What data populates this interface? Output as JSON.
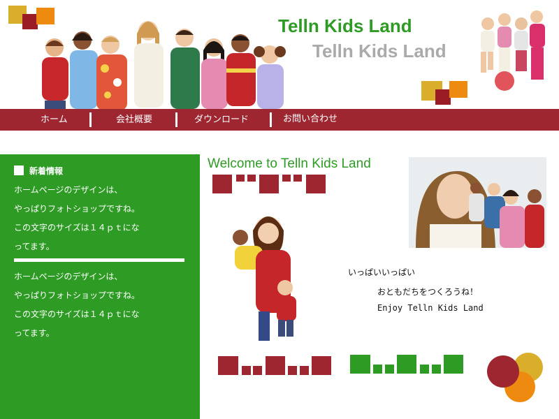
{
  "header": {
    "title": "Telln Kids Land",
    "title_shadow": "Telln Kids Land"
  },
  "nav": {
    "items": [
      {
        "label": "ホーム"
      },
      {
        "label": "会社概要"
      },
      {
        "label": "ダウンロード"
      },
      {
        "label": "お問い合わせ"
      }
    ]
  },
  "sidebar": {
    "heading": "新着情報",
    "news": [
      [
        "ホームページのデザインは、",
        "やっぱりフォトショップですね。",
        "この文字のサイズは１４ｐｔにな",
        "ってます。"
      ],
      [
        "ホームページのデザインは、",
        "やっぱりフォトショップですね。",
        "この文字のサイズは１４ｐｔにな",
        "ってます。"
      ]
    ]
  },
  "main": {
    "welcome": "Welcome to Telln Kids Land",
    "messages": [
      "いっぱいいっぱい",
      "おともだちをつくろうね！",
      "Enjoy Telln Kids Land"
    ]
  },
  "colors": {
    "brand_green": "#2e9b24",
    "brand_red": "#9e2630",
    "accent_yellow": "#d9ae2a",
    "accent_orange": "#ee8a10"
  },
  "icons": [
    "square-bullet-icon"
  ]
}
